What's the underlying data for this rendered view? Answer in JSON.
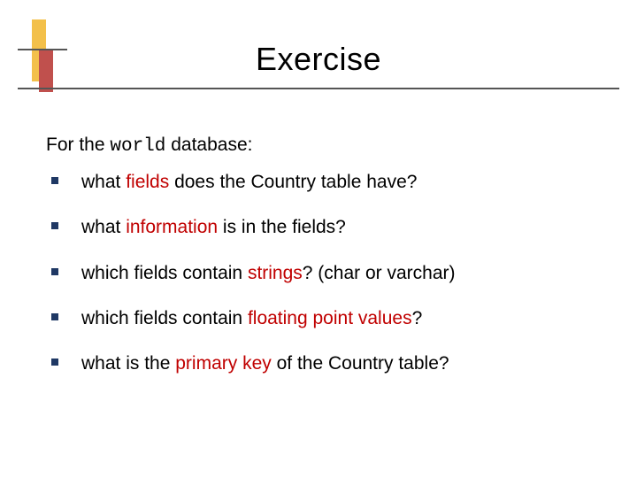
{
  "title": "Exercise",
  "intro": {
    "prefix": "For the ",
    "code": "world",
    "suffix": " database:"
  },
  "bullets": [
    {
      "pre": "what ",
      "hl": "fields",
      "post": " does the Country table have?"
    },
    {
      "pre": "what ",
      "hl": "information",
      "post": " is in the fields?"
    },
    {
      "pre": "which fields contain ",
      "hl": "strings",
      "post": "? (char or varchar)"
    },
    {
      "pre": "which fields contain ",
      "hl": "floating point values",
      "post": "?"
    },
    {
      "pre": "what is the ",
      "hl": "primary key",
      "post": " of the Country table?"
    }
  ]
}
